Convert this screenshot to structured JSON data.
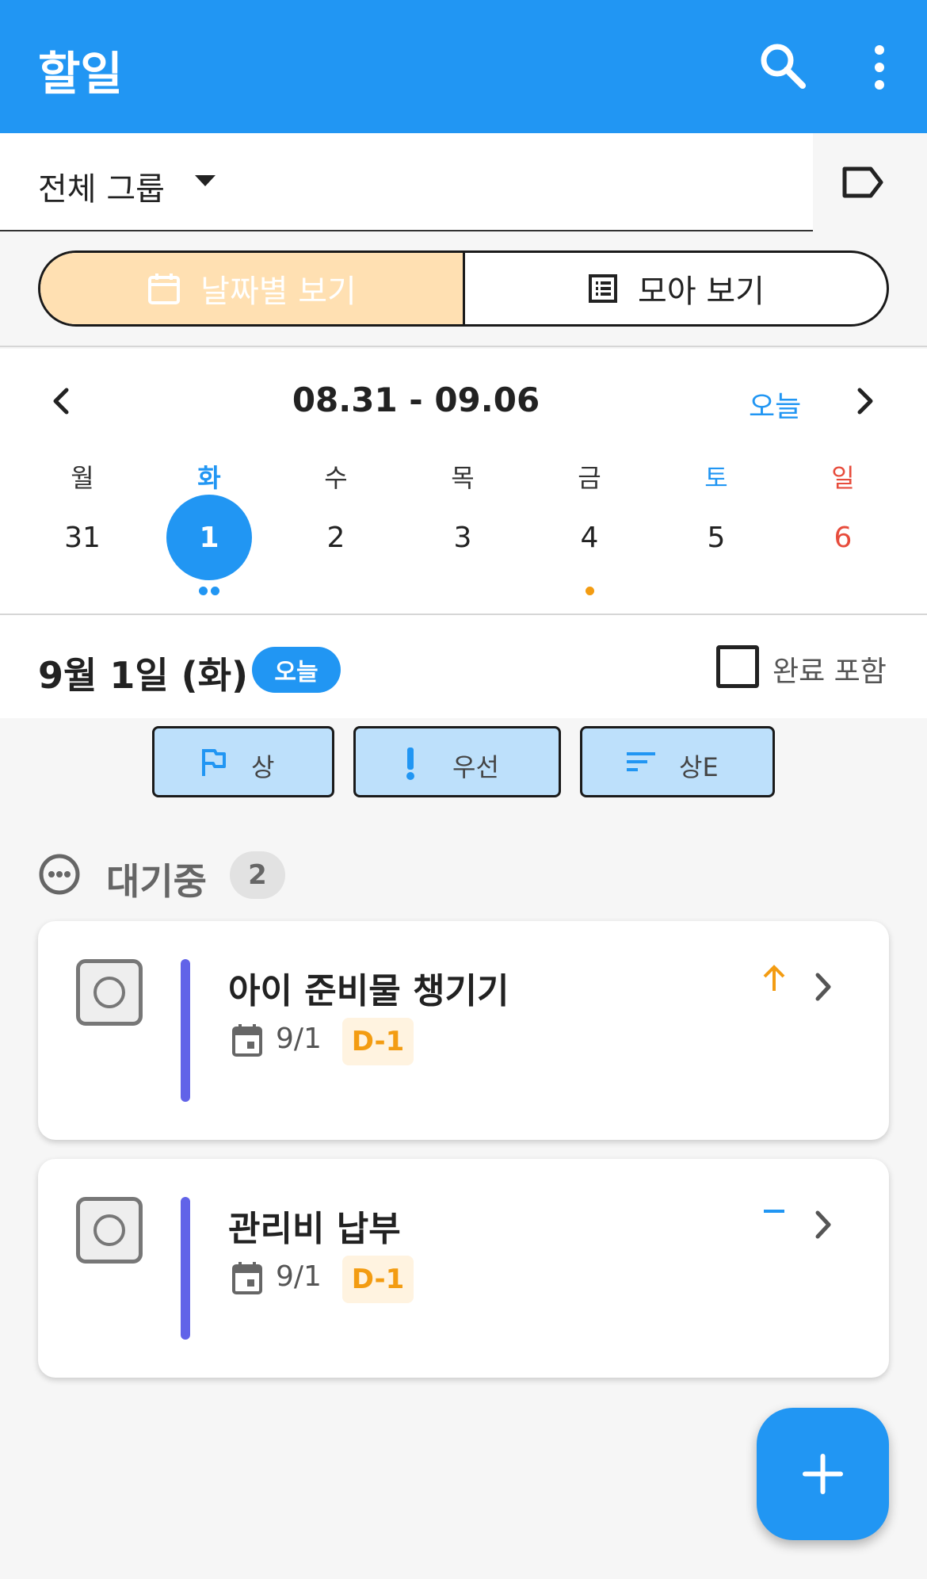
{
  "app_bar": {
    "title": "할일",
    "search_icon": "search-icon",
    "more_icon": "more-vertical-icon",
    "color": "#2196f3"
  },
  "group_selector": {
    "label": "전체 그룹",
    "tag_icon": "label-tag-icon"
  },
  "view_toggle": {
    "date_view_label": "날짜별 보기",
    "list_view_label": "모아 보기",
    "active": "date_view"
  },
  "calendar": {
    "range": "08.31 - 09.06",
    "today_label": "오늘",
    "weekdays": [
      "월",
      "화",
      "수",
      "목",
      "금",
      "토",
      "일"
    ],
    "dates": [
      "31",
      "1",
      "2",
      "3",
      "4",
      "5",
      "6"
    ],
    "selected_date": "1",
    "colors": {
      "saturday": "#2196f3",
      "sunday": "#e74c3c",
      "selected": "#2196f3"
    }
  },
  "day_header": {
    "date": "9월 1일 (화)",
    "today_badge": "오늘",
    "include_done_label": "완료 포함",
    "include_done_checked": false
  },
  "filters": [
    {
      "label": "상",
      "icon": "flag-icon"
    },
    {
      "label": "우선",
      "icon": "exclamation-icon"
    },
    {
      "label": "상E",
      "icon": "sort-icon"
    }
  ],
  "section": {
    "title": "대기중",
    "count": "2",
    "icon": "more-horizontal-circle-icon"
  },
  "tasks": [
    {
      "title": "아이 준비물 챙기기",
      "due": "9/1",
      "dday": "D-1",
      "priority": "high",
      "priority_icon": "arrow-up-icon",
      "bar_color": "#6163e8"
    },
    {
      "title": "관리비 납부",
      "due": "9/1",
      "dday": "D-1",
      "priority": "normal",
      "priority_icon": "dash-icon",
      "bar_color": "#6163e8"
    }
  ],
  "fab": {
    "icon": "plus-icon"
  }
}
